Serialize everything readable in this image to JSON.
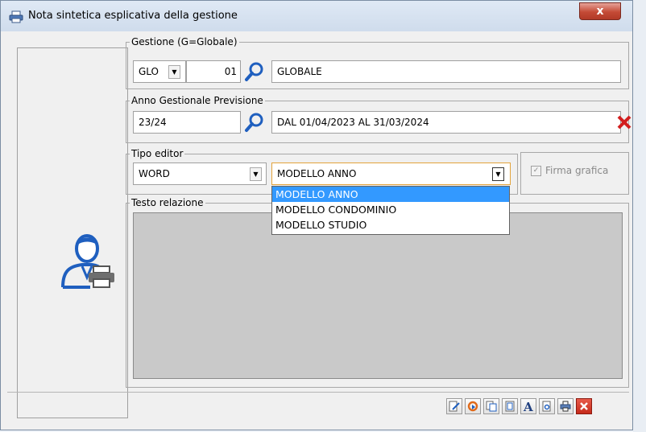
{
  "window": {
    "title": "Nota sintetica esplicativa della gestione",
    "close_label": "x"
  },
  "gestione": {
    "legend": "Gestione (G=Globale)",
    "code_value": "GLO",
    "number_value": "01",
    "description_value": "GLOBALE"
  },
  "anno": {
    "legend": "Anno Gestionale Previsione",
    "value": "23/24",
    "description_value": "DAL 01/04/2023 AL 31/03/2024"
  },
  "tipo_editor": {
    "legend": "Tipo editor",
    "editor_value": "WORD",
    "modello_value": "MODELLO ANNO",
    "options": [
      "MODELLO ANNO",
      "MODELLO CONDOMINIO",
      "MODELLO STUDIO"
    ],
    "selected_index": 0
  },
  "firma": {
    "label": "Firma grafica",
    "checked": true
  },
  "testo": {
    "legend": "Testo relazione"
  },
  "toolbar": {
    "icons": [
      "edit-document-icon",
      "refresh-icon",
      "copy-document-icon",
      "page-setup-icon",
      "font-icon",
      "print-preview-icon",
      "print-icon",
      "close-icon"
    ]
  },
  "colors": {
    "selection": "#3399ff",
    "close_red": "#d21e1e",
    "lens_blue": "#1f5fbf"
  }
}
